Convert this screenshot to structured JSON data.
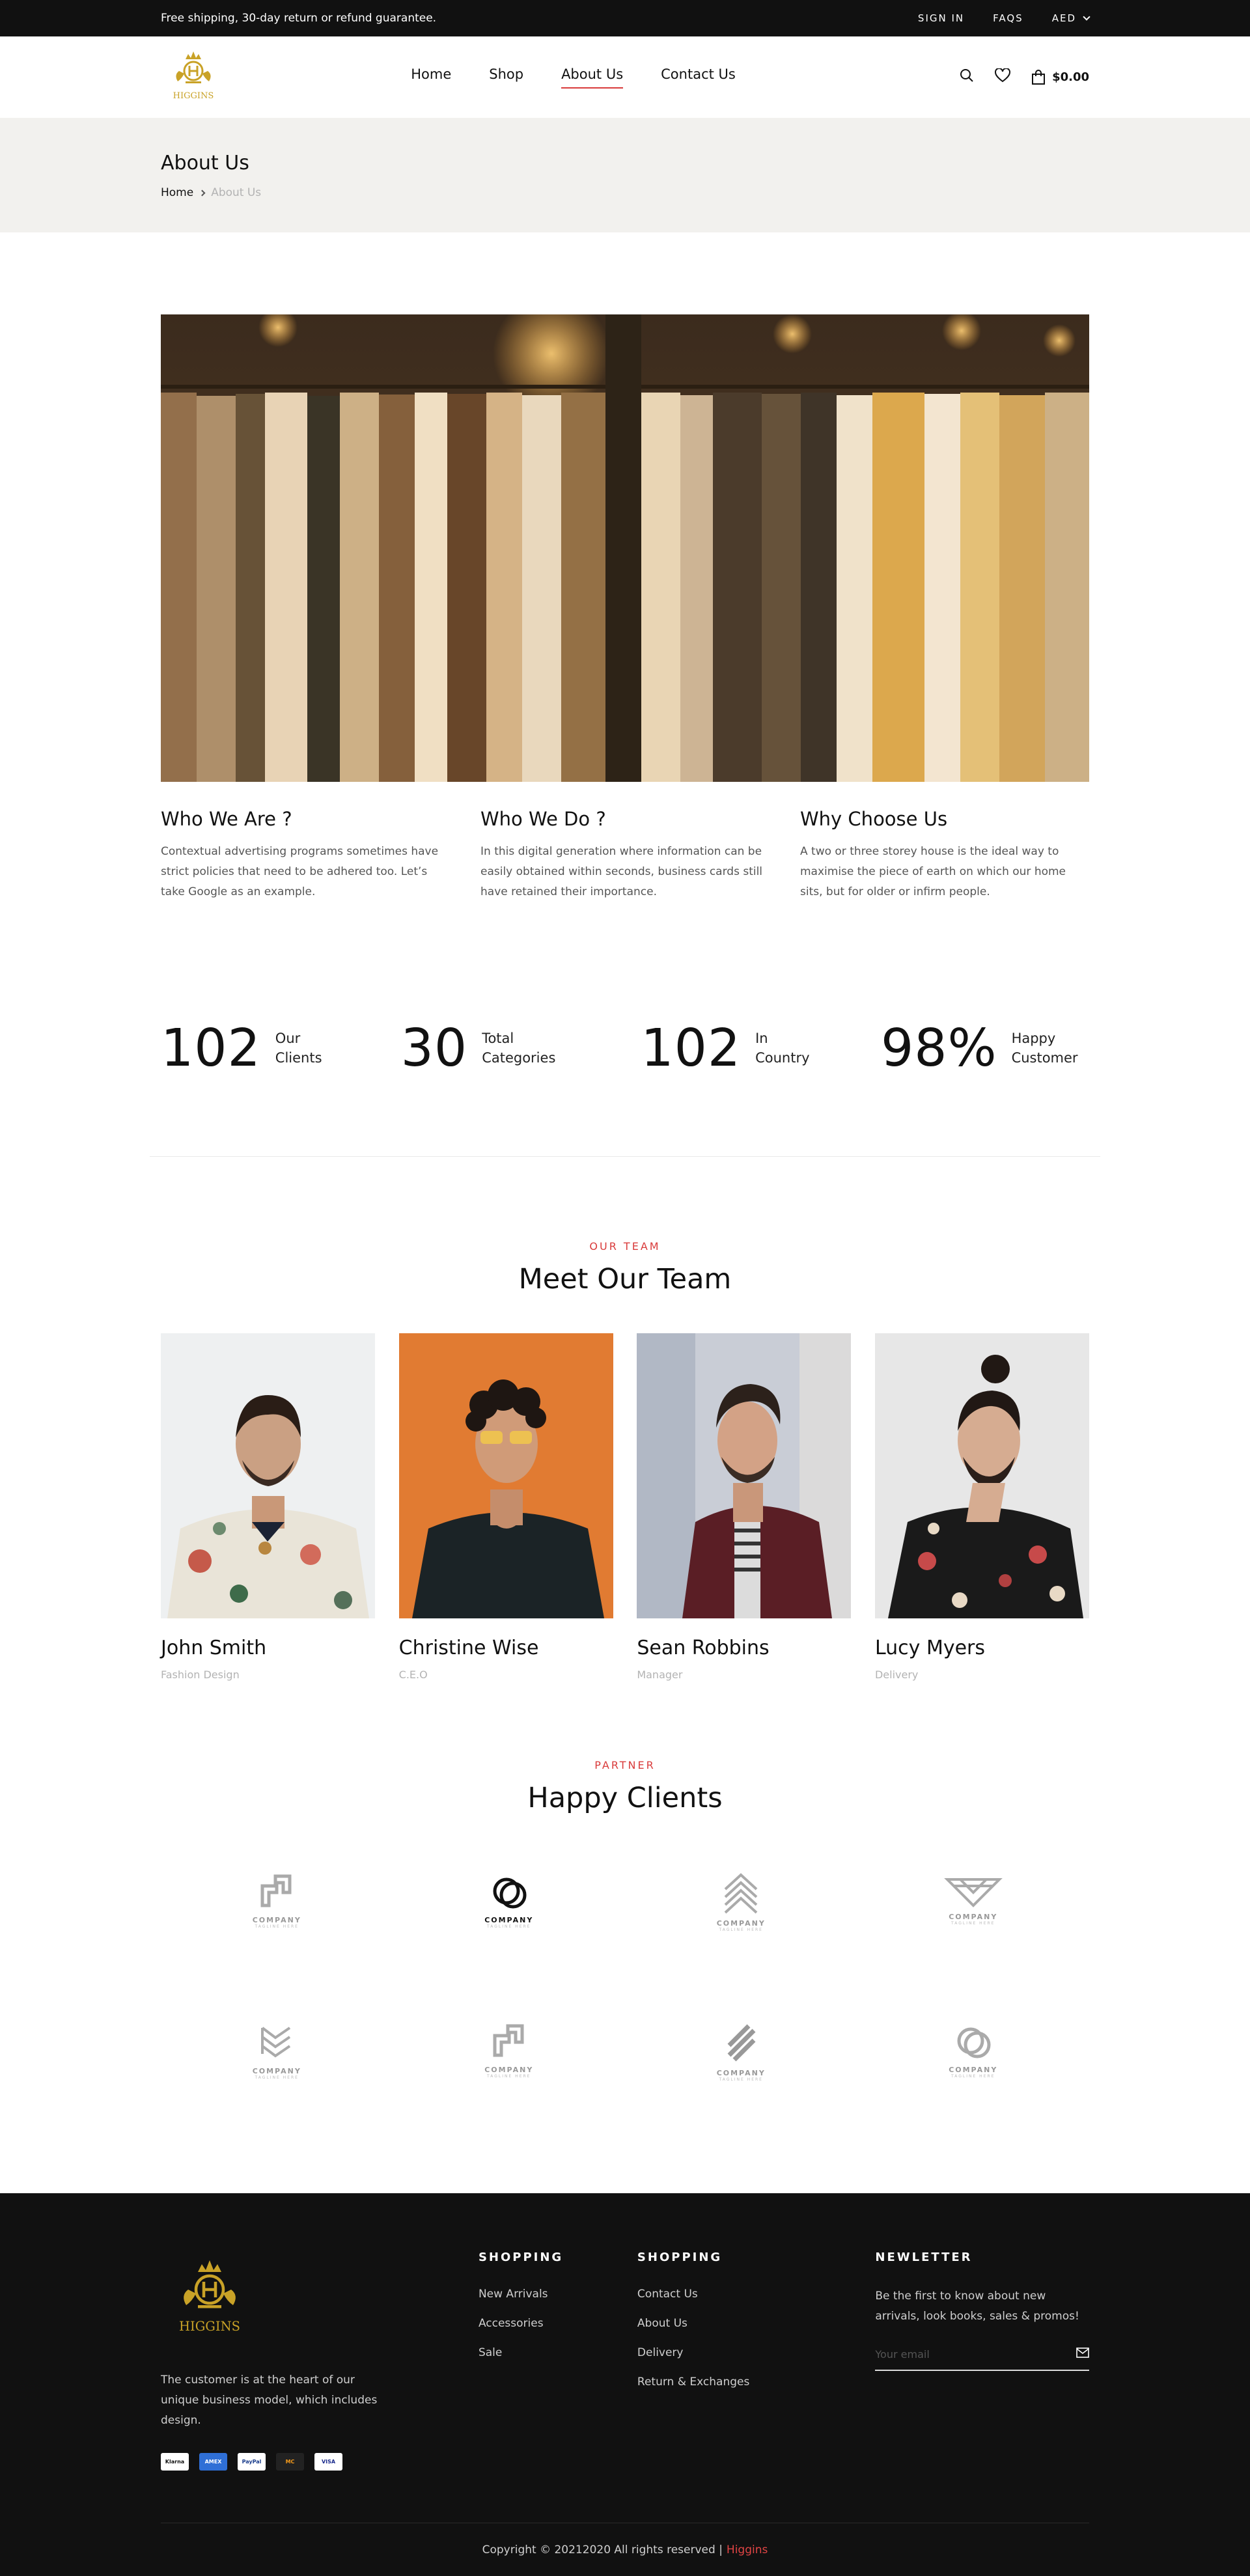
{
  "topbar": {
    "promo": "Free shipping, 30-day return or refund guarantee.",
    "sign_in": "SIGN IN",
    "faqs": "FAQS",
    "currency": "AED"
  },
  "header": {
    "logo_text": "HIGGINS",
    "nav": [
      "Home",
      "Shop",
      "About Us",
      "Contact Us"
    ],
    "active_nav": "About Us",
    "cart_total": "$0.00"
  },
  "page_title": {
    "title": "About Us",
    "breadcrumb_home": "Home",
    "breadcrumb_current": "About Us"
  },
  "info": [
    {
      "title": "Who We Are ?",
      "text": "Contextual advertising programs sometimes have strict policies that need to be adhered too. Let’s take Google as an example."
    },
    {
      "title": "Who We Do ?",
      "text": "In this digital generation where information can be easily obtained within seconds, business cards still have retained their importance."
    },
    {
      "title": "Why Choose Us",
      "text": "A two or three storey house is the ideal way to maximise the piece of earth on which our home sits, but for older or infirm people."
    }
  ],
  "stats": [
    {
      "num": "102",
      "line1": "Our",
      "line2": "Clients"
    },
    {
      "num": "30",
      "line1": "Total",
      "line2": "Categories"
    },
    {
      "num": "102",
      "line1": "In",
      "line2": "Country"
    },
    {
      "num": "98%",
      "line1": "Happy",
      "line2": "Customer"
    }
  ],
  "team": {
    "kicker": "OUR TEAM",
    "title": "Meet Our Team",
    "members": [
      {
        "name": "John Smith",
        "role": "Fashion Design"
      },
      {
        "name": "Christine Wise",
        "role": "C.E.O"
      },
      {
        "name": "Sean Robbins",
        "role": "Manager"
      },
      {
        "name": "Lucy Myers",
        "role": "Delivery"
      }
    ]
  },
  "clients": {
    "kicker": "PARTNER",
    "title": "Happy Clients",
    "logo_label": "COMPANY",
    "logo_tag": "TAGLINE HERE"
  },
  "footer": {
    "logo_text": "HIGGINS",
    "about": "The customer is at the heart of our unique business model, which includes design.",
    "payments": [
      "Klarna",
      "AMEX",
      "PayPal",
      "MC",
      "VISA"
    ],
    "col1_title": "SHOPPING",
    "col1": [
      "New Arrivals",
      "Accessories",
      "Sale"
    ],
    "col2_title": "SHOPPING",
    "col2": [
      "Contact Us",
      "About Us",
      "Delivery",
      "Return & Exchanges"
    ],
    "news_title": "NEWLETTER",
    "news_text": "Be the first to know about new arrivals, look books, sales & promos!",
    "email_placeholder": "Your email",
    "copyright": "Copyright © 20212020 All rights reserved |",
    "brand": "Higgins"
  },
  "colors": {
    "accent": "#d93b3b",
    "dark": "#111111",
    "title_bg": "#f2f1ee",
    "gold": "#c9a227"
  }
}
